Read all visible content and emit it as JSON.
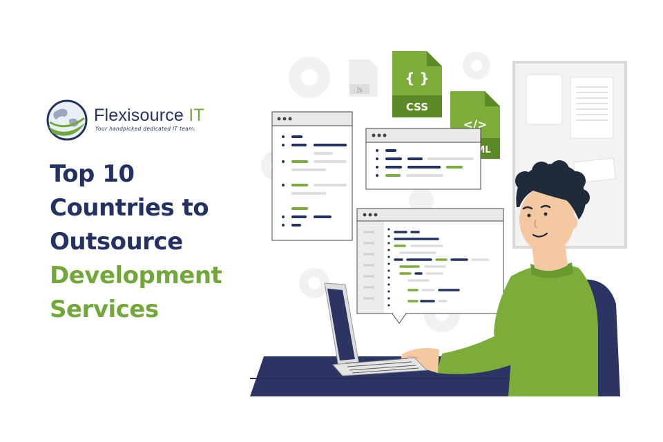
{
  "brand": {
    "name": "Flexisource",
    "name_suffix": "IT",
    "tagline": "Your handpicked dedicated IT team."
  },
  "headline": {
    "lines": [
      "Top 10",
      "Countries to",
      "Outsource",
      "Development",
      "Services"
    ]
  },
  "file_icons": {
    "js": "Js",
    "css": "CSS",
    "css_glyph": "{ }",
    "html": "</>",
    "html_partial": "ML"
  },
  "colors": {
    "navy": "#233262",
    "green": "#72a83a",
    "shirt": "#7cad3b",
    "desk": "#2c3464"
  }
}
